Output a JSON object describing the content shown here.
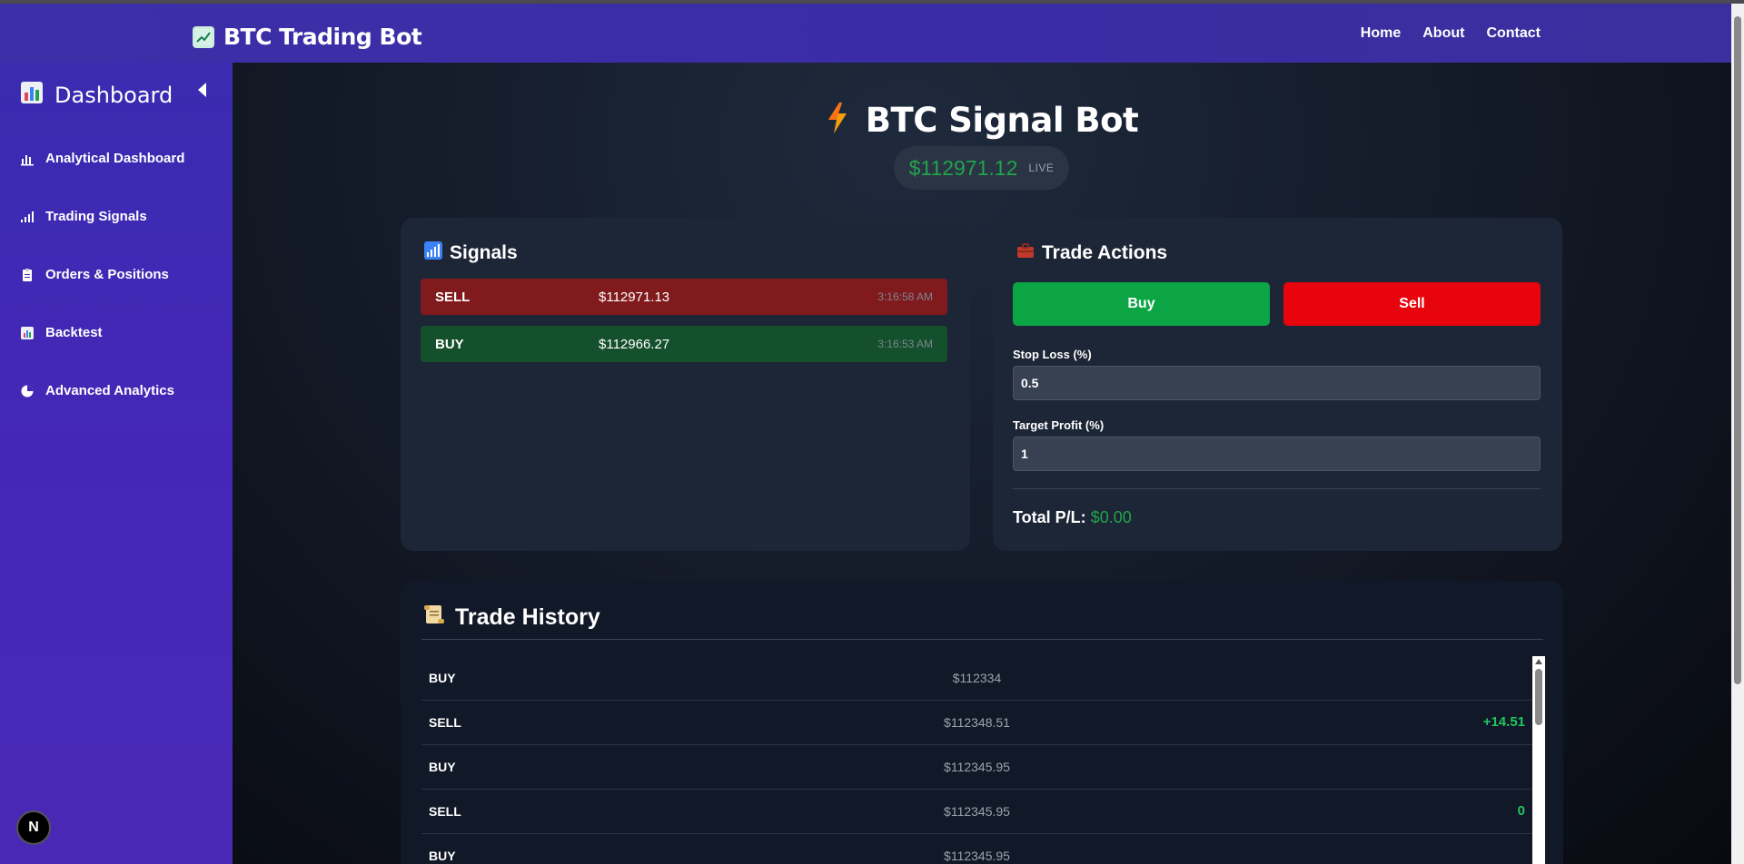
{
  "navbar": {
    "brand": "BTC Trading Bot",
    "links": [
      "Home",
      "About",
      "Contact"
    ]
  },
  "sidebar": {
    "title": "Dashboard",
    "items": [
      {
        "label": "Analytical Dashboard",
        "icon": "bar-chart-icon"
      },
      {
        "label": "Trading Signals",
        "icon": "signal-bars-icon"
      },
      {
        "label": "Orders & Positions",
        "icon": "clipboard-icon"
      },
      {
        "label": "Backtest",
        "icon": "chart-icon"
      },
      {
        "label": "Advanced Analytics",
        "icon": "pie-chart-icon"
      }
    ],
    "badge": "N"
  },
  "header": {
    "title": "BTC Signal Bot",
    "price": "$112971.12",
    "live": "LIVE"
  },
  "signals": {
    "title": "Signals",
    "rows": [
      {
        "type": "SELL",
        "price": "$112971.13",
        "time": "3:16:58 AM"
      },
      {
        "type": "BUY",
        "price": "$112966.27",
        "time": "3:16:53 AM"
      }
    ]
  },
  "trade": {
    "title": "Trade Actions",
    "buy_label": "Buy",
    "sell_label": "Sell",
    "stop_loss_label": "Stop Loss (%)",
    "stop_loss_value": "0.5",
    "target_label": "Target Profit (%)",
    "target_value": "1",
    "pl_label": "Total P/L:",
    "pl_value": "$0.00"
  },
  "history": {
    "title": "Trade History",
    "rows": [
      {
        "type": "BUY",
        "price": "$112334",
        "pnl": ""
      },
      {
        "type": "SELL",
        "price": "$112348.51",
        "pnl": "+14.51"
      },
      {
        "type": "BUY",
        "price": "$112345.95",
        "pnl": ""
      },
      {
        "type": "SELL",
        "price": "$112345.95",
        "pnl": "0"
      },
      {
        "type": "BUY",
        "price": "$112345.95",
        "pnl": ""
      }
    ]
  },
  "colors": {
    "accent": "#3d2fa8",
    "positive": "#22a34b",
    "buy": "#0ca545",
    "sell": "#e8040c"
  }
}
